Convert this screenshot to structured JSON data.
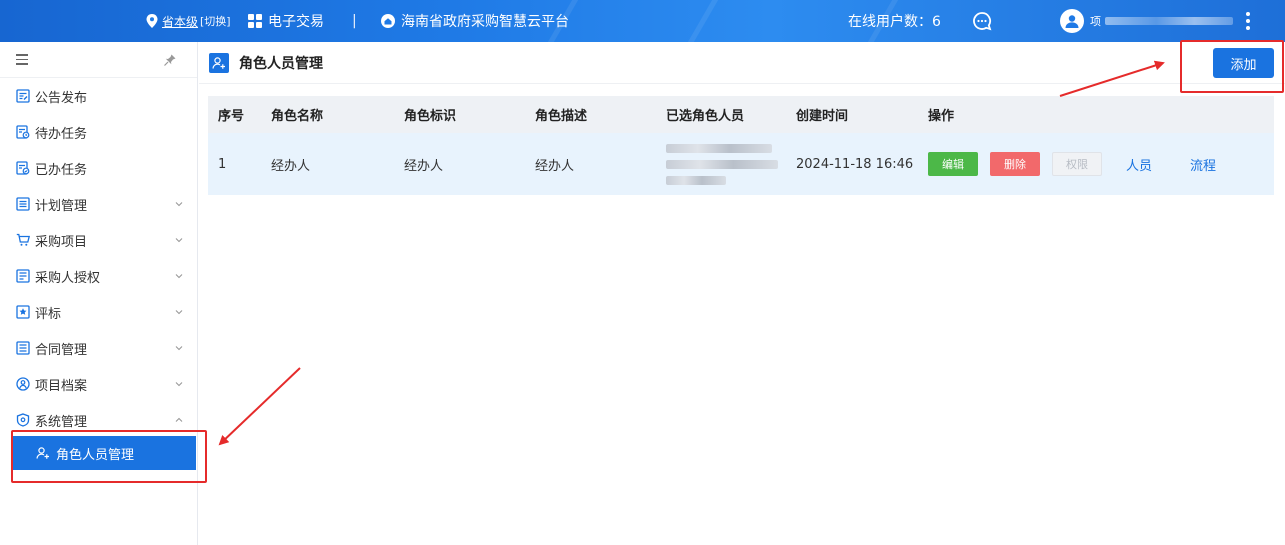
{
  "topbar": {
    "region": "省本级",
    "switch_label": "[切换]",
    "system": "电子交易",
    "separator": "|",
    "platform": "海南省政府采购智慧云平台",
    "online_users": "在线用户数：6",
    "user_name_prefix": "项",
    "colors": {
      "background": "#1f7ae6"
    }
  },
  "sidebar": {
    "items": [
      {
        "label": "公告发布",
        "icon": "announcement-icon",
        "expandable": false
      },
      {
        "label": "待办任务",
        "icon": "todo-task-icon",
        "expandable": false
      },
      {
        "label": "已办任务",
        "icon": "done-task-icon",
        "expandable": false
      },
      {
        "label": "计划管理",
        "icon": "plan-icon",
        "expandable": true
      },
      {
        "label": "采购项目",
        "icon": "cart-icon",
        "expandable": true
      },
      {
        "label": "采购人授权",
        "icon": "authorization-icon",
        "expandable": true
      },
      {
        "label": "评标",
        "icon": "evaluation-icon",
        "expandable": true
      },
      {
        "label": "合同管理",
        "icon": "contract-icon",
        "expandable": true
      },
      {
        "label": "项目档案",
        "icon": "archive-icon",
        "expandable": true
      },
      {
        "label": "系统管理",
        "icon": "system-icon",
        "expandable": true,
        "expanded": true
      }
    ],
    "active_subitem": {
      "label": "角色人员管理",
      "icon": "role-user-icon"
    }
  },
  "main": {
    "title": "角色人员管理",
    "add_button": "添加",
    "table": {
      "headers": [
        "序号",
        "角色名称",
        "角色标识",
        "角色描述",
        "已选角色人员",
        "创建时间",
        "操作"
      ],
      "rows": [
        {
          "index": "1",
          "role_name": "经办人",
          "role_id": "经办人",
          "role_desc": "经办人",
          "created": "2024-11-18 16:46",
          "actions": {
            "edit": "编辑",
            "delete": "删除",
            "permission": "权限",
            "people": "人员",
            "workflow": "流程"
          }
        }
      ]
    }
  },
  "colors": {
    "accent": "#1a73e0",
    "edit": "#4cb848",
    "delete": "#f2696b",
    "annotation": "#e52b2b"
  }
}
